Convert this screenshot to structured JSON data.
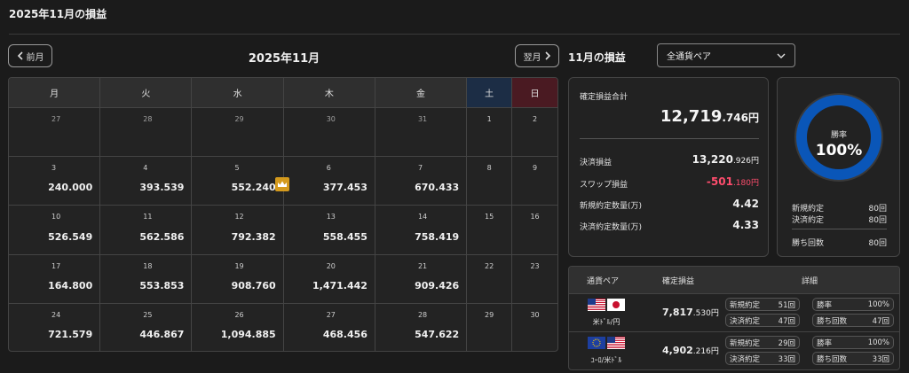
{
  "page_title": "2025年11月の損益",
  "nav": {
    "prev_label": "前月",
    "next_label": "翌月",
    "prev_icon": "chevron-left-icon",
    "next_icon": "chevron-right-icon"
  },
  "calendar": {
    "month_label": "2025年11月",
    "weekdays": [
      "月",
      "火",
      "水",
      "木",
      "金",
      "土",
      "日"
    ],
    "weekday_colors": {
      "sat": "#1c2d45",
      "sun": "#4a1a22"
    },
    "weeks": [
      [
        {
          "day": "27",
          "value": ""
        },
        {
          "day": "28",
          "value": ""
        },
        {
          "day": "29",
          "value": ""
        },
        {
          "day": "30",
          "value": ""
        },
        {
          "day": "31",
          "value": ""
        },
        {
          "day": "1",
          "value": ""
        },
        {
          "day": "2",
          "value": ""
        }
      ],
      [
        {
          "day": "3",
          "value": "240.000"
        },
        {
          "day": "4",
          "value": "393.539"
        },
        {
          "day": "5",
          "value": "552.240"
        },
        {
          "day": "6",
          "value": "377.453"
        },
        {
          "day": "7",
          "value": "670.433"
        },
        {
          "day": "8",
          "value": ""
        },
        {
          "day": "9",
          "value": ""
        }
      ],
      [
        {
          "day": "10",
          "value": "526.549"
        },
        {
          "day": "11",
          "value": "562.586"
        },
        {
          "day": "12",
          "value": "792.382"
        },
        {
          "day": "13",
          "value": "558.455"
        },
        {
          "day": "14",
          "value": "758.419"
        },
        {
          "day": "15",
          "value": ""
        },
        {
          "day": "16",
          "value": ""
        }
      ],
      [
        {
          "day": "17",
          "value": "164.800"
        },
        {
          "day": "18",
          "value": "553.853"
        },
        {
          "day": "19",
          "value": "908.760"
        },
        {
          "day": "20",
          "value": "1,471.442"
        },
        {
          "day": "21",
          "value": "909.426"
        },
        {
          "day": "22",
          "value": ""
        },
        {
          "day": "23",
          "value": ""
        }
      ],
      [
        {
          "day": "24",
          "value": "721.579"
        },
        {
          "day": "25",
          "value": "446.867"
        },
        {
          "day": "26",
          "value": "1,094.885"
        },
        {
          "day": "27",
          "value": "468.456"
        },
        {
          "day": "28",
          "value": "547.622"
        },
        {
          "day": "29",
          "value": ""
        },
        {
          "day": "30",
          "value": ""
        }
      ]
    ],
    "best_day_icon": "crown-icon"
  },
  "summary": {
    "title": "11月の損益",
    "pair_select": "全通貨ペア",
    "total_label": "確定損益合計",
    "total_main": "12,719",
    "total_dec": ".746",
    "yen": "円",
    "settle_label": "決済損益",
    "settle_main": "13,220",
    "settle_dec": ".926",
    "swap_label": "スワップ損益",
    "swap_main": "-501",
    "swap_dec": ".180",
    "new_qty_label": "新規約定数量(万)",
    "new_qty": "4.42",
    "settle_qty_label": "決済約定数量(万)",
    "settle_qty": "4.33"
  },
  "win_rate": {
    "label": "勝率",
    "value": "100%",
    "rate": 1.0,
    "ring_color": "#0a56b8",
    "new_label": "新規約定",
    "new_count": "80回",
    "settle_label": "決済約定",
    "settle_count": "80回",
    "wins_label": "勝ち回数",
    "wins_count": "80回"
  },
  "pairs": {
    "headers": [
      "通貨ペア",
      "確定損益",
      "詳細"
    ],
    "rows": [
      {
        "name": "米ﾄﾞﾙ/円",
        "profit_main": "7,817",
        "profit_dec": ".530",
        "yen": "円",
        "new_label": "新規約定",
        "new_count": "51回",
        "rate_label": "勝率",
        "rate": "100%",
        "settle_label": "決済約定",
        "settle_count": "47回",
        "wins_label": "勝ち回数",
        "wins_count": "47回",
        "flag1": "us-flag-icon",
        "flag2": "jp-flag-icon"
      },
      {
        "name": "ﾕｰﾛ/米ﾄﾞﾙ",
        "profit_main": "4,902",
        "profit_dec": ".216",
        "yen": "円",
        "new_label": "新規約定",
        "new_count": "29回",
        "rate_label": "勝率",
        "rate": "100%",
        "settle_label": "決済約定",
        "settle_count": "33回",
        "wins_label": "勝ち回数",
        "wins_count": "33回",
        "flag1": "eu-flag-icon",
        "flag2": "us-flag-icon"
      }
    ]
  }
}
